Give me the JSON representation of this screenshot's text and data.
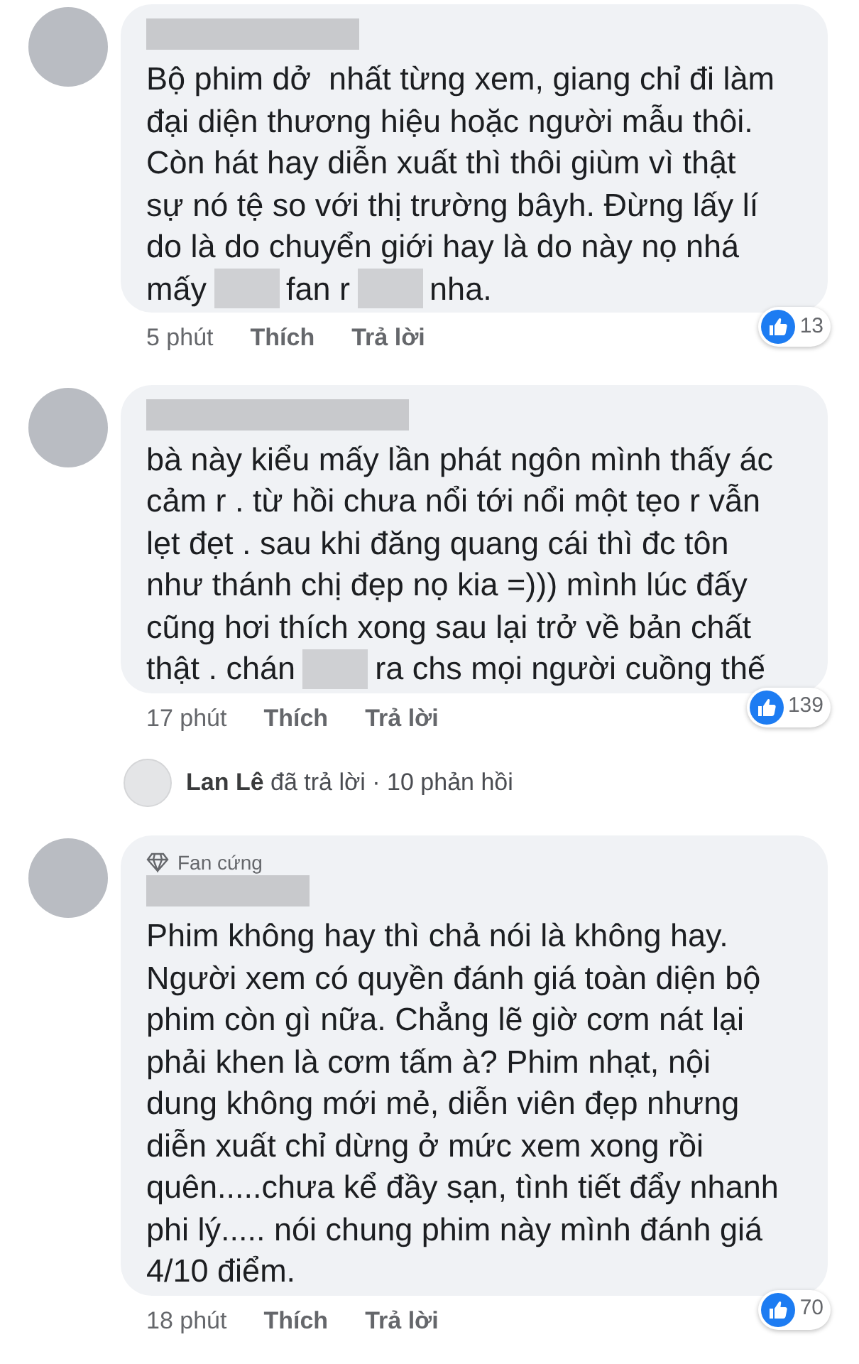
{
  "comments": [
    {
      "lines": [
        [
          {
            "kind": "text",
            "text": "Bộ phim dở  nhất từng xem, giang chỉ đi làm"
          }
        ],
        [
          {
            "kind": "text",
            "text": "đại diện thương hiệu hoặc người mẫu thôi."
          }
        ],
        [
          {
            "kind": "text",
            "text": "Còn hát hay diễn xuất thì thôi giùm vì thật"
          }
        ],
        [
          {
            "kind": "text",
            "text": "sự nó tệ so với thị trường bâyh. Đừng lấy lí"
          }
        ],
        [
          {
            "kind": "text",
            "text": "do là do chuyển giới hay là do này nọ nhá"
          }
        ],
        [
          {
            "kind": "text",
            "text": "mấy"
          },
          {
            "kind": "redacted"
          },
          {
            "kind": "text",
            "text": "fan r"
          },
          {
            "kind": "redacted"
          },
          {
            "kind": "text",
            "text": "nha."
          }
        ]
      ],
      "time": "5 phút",
      "like": "Thích",
      "reply": "Trả lời",
      "reaction_count": "13"
    },
    {
      "lines": [
        [
          {
            "kind": "text",
            "text": "bà này kiểu mấy lần phát ngôn mình thấy ác"
          }
        ],
        [
          {
            "kind": "text",
            "text": "cảm r . từ hồi chưa nổi tới nổi một tẹo r vẫn"
          }
        ],
        [
          {
            "kind": "text",
            "text": "lẹt đẹt . sau khi đăng quang cái thì đc tôn"
          }
        ],
        [
          {
            "kind": "text",
            "text": "như thánh chị đẹp nọ kia =))) mình lúc đấy"
          }
        ],
        [
          {
            "kind": "text",
            "text": "cũng hơi thích xong sau lại trở về bản chất"
          }
        ],
        [
          {
            "kind": "text",
            "text": "thật . chán"
          },
          {
            "kind": "redacted"
          },
          {
            "kind": "text",
            "text": "ra chs mọi người cuồng thế"
          }
        ]
      ],
      "time": "17 phút",
      "like": "Thích",
      "reply": "Trả lời",
      "reaction_count": "139",
      "replies": {
        "author": "Lan Lê",
        "text": "đã trả lời · 10 phản hồi"
      }
    },
    {
      "badge": "Fan cứng",
      "lines": [
        [
          {
            "kind": "text",
            "text": "Phim không hay thì chả nói là không hay."
          }
        ],
        [
          {
            "kind": "text",
            "text": "Người xem có quyền đánh giá toàn diện bộ"
          }
        ],
        [
          {
            "kind": "text",
            "text": "phim còn gì nữa. Chẳng lẽ giờ cơm nát lại"
          }
        ],
        [
          {
            "kind": "text",
            "text": "phải khen là cơm tấm à? Phim nhạt, nội"
          }
        ],
        [
          {
            "kind": "text",
            "text": "dung không mới mẻ, diễn viên đẹp nhưng"
          }
        ],
        [
          {
            "kind": "text",
            "text": "diễn xuất chỉ dừng ở mức xem xong rồi"
          }
        ],
        [
          {
            "kind": "text",
            "text": "quên.....chưa kể đầy sạn, tình tiết đẩy nhanh"
          }
        ],
        [
          {
            "kind": "text",
            "text": "phi lý..... nói chung phim này mình đánh giá"
          }
        ],
        [
          {
            "kind": "text",
            "text": "4/10 điểm."
          }
        ]
      ],
      "time": "18 phút",
      "like": "Thích",
      "reply": "Trả lời",
      "reaction_count": "70"
    }
  ]
}
